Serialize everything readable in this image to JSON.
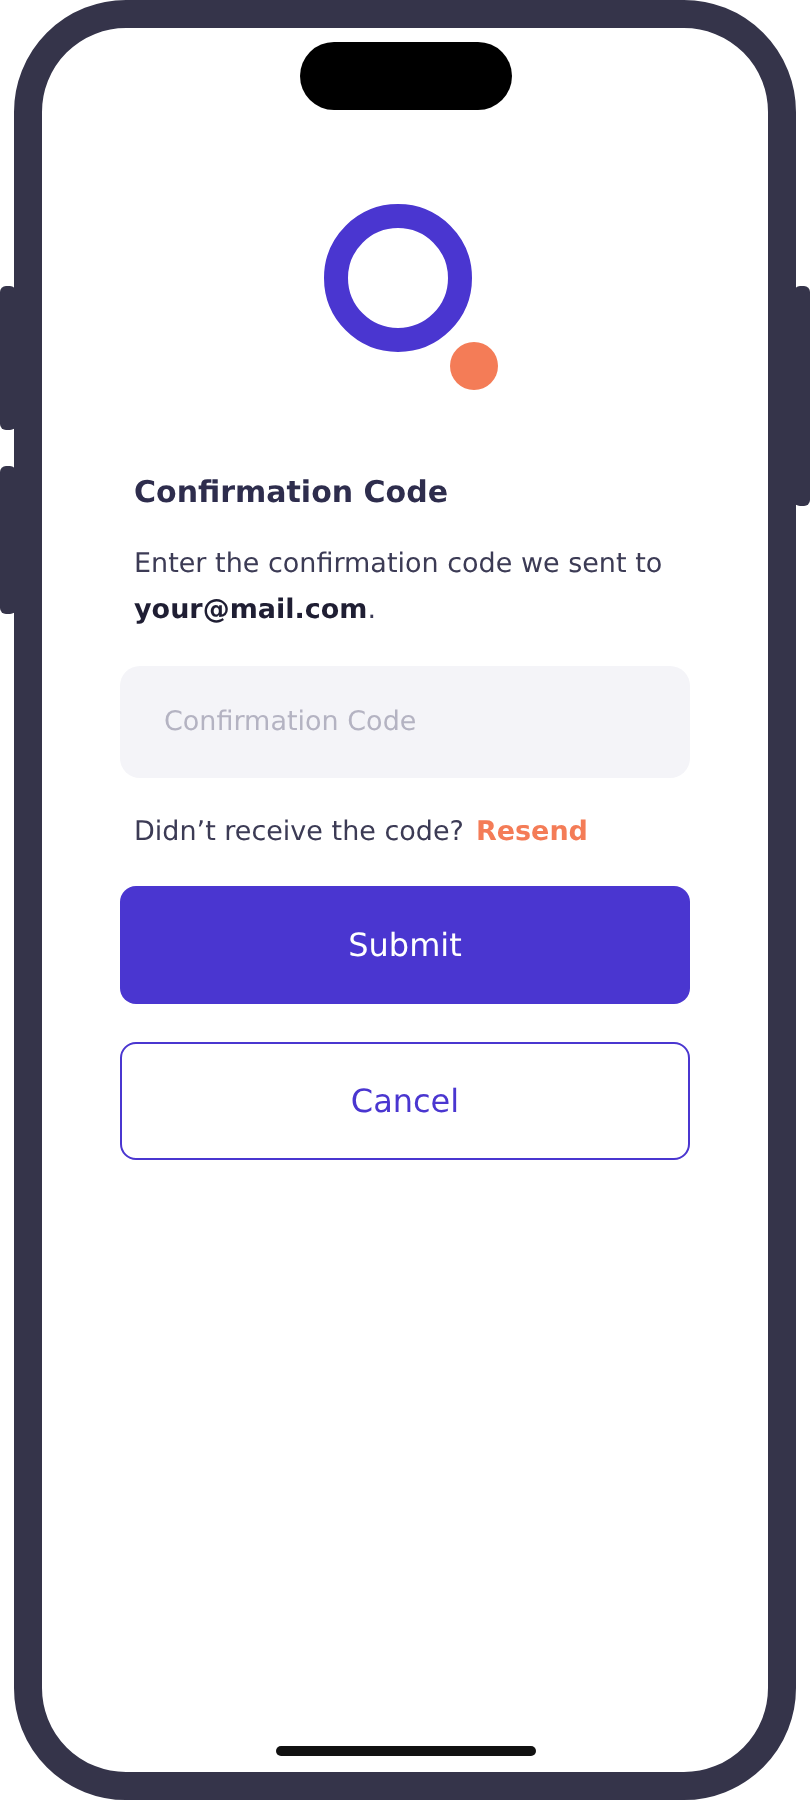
{
  "title": "Confirmation Code",
  "message": "Enter the confirmation code we sent to **your@mail.com**.",
  "code_field": {
    "placeholder": "Confirmation Code"
  },
  "resend": {
    "prompt": "Didn’t receive the code?",
    "link": "Resend"
  },
  "buttons": [
    {
      "label": "Submit",
      "kind": "primary"
    },
    {
      "label": "Cancel",
      "kind": "secondary"
    }
  ]
}
